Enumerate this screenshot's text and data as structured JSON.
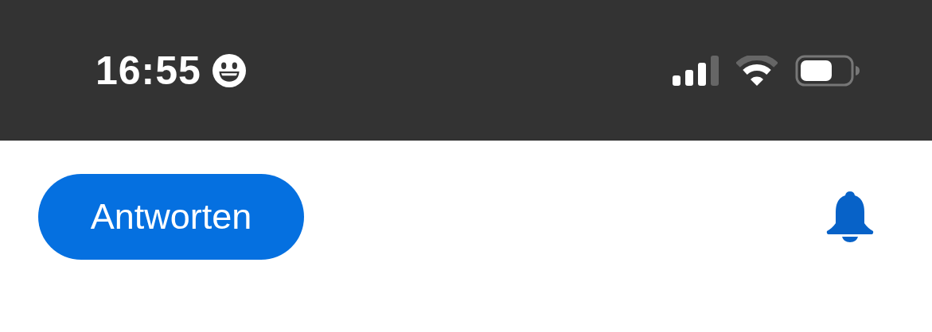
{
  "status_bar": {
    "time": "16:55"
  },
  "toolbar": {
    "reply_button": "Antworten"
  }
}
